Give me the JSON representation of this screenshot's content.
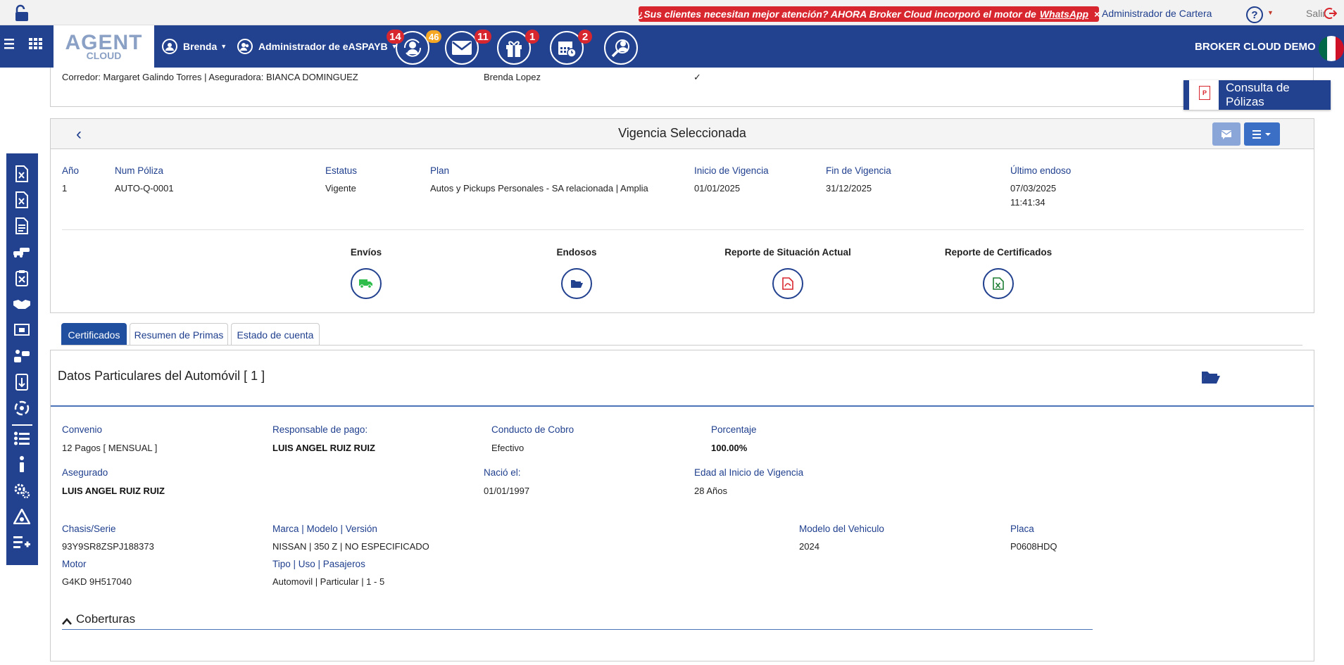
{
  "topbar": {
    "promo_text": "¿Sus clientes necesitan mejor atención? AHORA Broker Cloud incorporó el motor de",
    "promo_link": "WhatsApp",
    "promo_close": "×",
    "role_link": "Administrador de Cartera",
    "help_label": "?",
    "logout_label": "Salir"
  },
  "navbar": {
    "logo_line1": "AGENT",
    "logo_line2": "CLOUD",
    "user_name": "Brenda",
    "admin_label": "Administrador de eASPAYB",
    "badges": {
      "clients": "14",
      "clients_secondary": "46",
      "messages": "11",
      "gifts": "1",
      "calendar": "2"
    },
    "company": "BROKER CLOUD DEMO"
  },
  "prev_row": {
    "corredor": "Corredor: Margaret Galindo Torres | Aseguradora: BIANCA DOMINGUEZ",
    "user": "Brenda Lopez",
    "check": "✓"
  },
  "consulta_button": "Consulta de Pólizas",
  "vigencia": {
    "title": "Vigencia Seleccionada",
    "labels": {
      "anio": "Año",
      "num_poliza": "Num Póliza",
      "estatus": "Estatus",
      "plan": "Plan",
      "inicio": "Inicio de Vigencia",
      "fin": "Fin de Vigencia",
      "ultimo_endoso": "Último endoso"
    },
    "values": {
      "anio": "1",
      "num_poliza": "AUTO-Q-0001",
      "estatus": "Vigente",
      "plan": "Autos y Pickups Personales - SA relacionada | Amplia",
      "inicio": "01/01/2025",
      "fin": "31/12/2025",
      "ultimo_endoso_fecha": "07/03/2025",
      "ultimo_endoso_hora": "11:41:34"
    },
    "actions": {
      "envios": "Envíos",
      "endosos": "Endosos",
      "reporte_situacion": "Reporte de Situación Actual",
      "reporte_certificados": "Reporte de Certificados"
    }
  },
  "tabs": {
    "certificados": "Certificados",
    "resumen": "Resumen de Primas",
    "estado": "Estado de cuenta"
  },
  "certificado": {
    "title": "Datos Particulares del Automóvil [ 1 ]",
    "labels": {
      "convenio": "Convenio",
      "responsable": "Responsable de pago:",
      "conducto": "Conducto de Cobro",
      "porcentaje": "Porcentaje",
      "asegurado": "Asegurado",
      "nacio": "Nació el:",
      "edad": "Edad al Inicio de Vigencia",
      "chasis": "Chasis/Serie",
      "marca": "Marca | Modelo | Versión",
      "modelo_vehiculo": "Modelo del Vehiculo",
      "placa": "Placa",
      "motor": "Motor",
      "tipo": "Tipo | Uso | Pasajeros"
    },
    "values": {
      "convenio": "12 Pagos [ MENSUAL ]",
      "responsable": "LUIS ANGEL RUIZ RUIZ",
      "conducto": "Efectivo",
      "porcentaje": "100.00%",
      "asegurado": "LUIS ANGEL RUIZ RUIZ",
      "nacio": "01/01/1997",
      "edad": "28 Años",
      "chasis": "93Y9SR8ZSPJ188373",
      "marca": "NISSAN | 350 Z | NO ESPECIFICADO",
      "modelo_vehiculo": "2024",
      "placa": "P0608HDQ",
      "motor": "G4KD 9H517040",
      "tipo": "Automovil | Particular | 1 - 5"
    },
    "coberturas": "Coberturas"
  },
  "colors": {
    "primary": "#22418f",
    "alert": "#d8262e",
    "accent_badge": "#f5a623"
  }
}
